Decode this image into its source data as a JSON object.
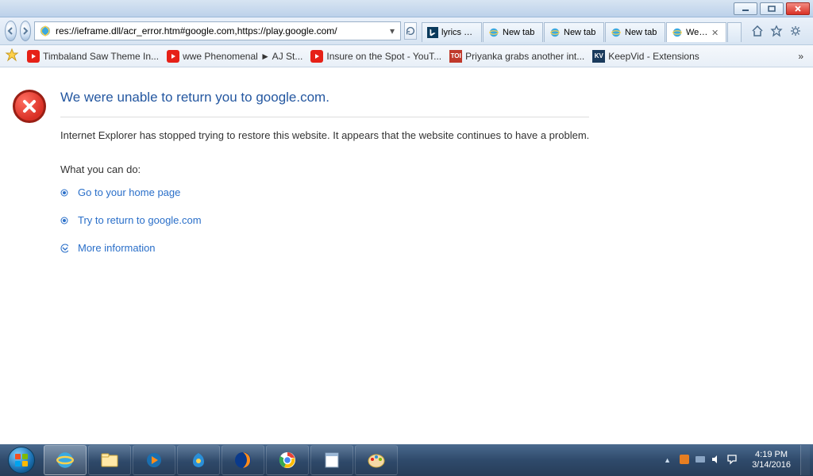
{
  "address": "res://ieframe.dll/acr_error.htm#google.com,https://play.google.com/",
  "tabs": [
    {
      "label": "lyrics + ...",
      "icon": "bing"
    },
    {
      "label": "New tab",
      "icon": "ie"
    },
    {
      "label": "New tab",
      "icon": "ie"
    },
    {
      "label": "New tab",
      "icon": "ie"
    },
    {
      "label": "Web...",
      "icon": "ie",
      "active": true
    }
  ],
  "favorites": [
    {
      "label": "Timbaland Saw Theme In...",
      "icon": "youtube"
    },
    {
      "label": "wwe Phenomenal ► AJ St...",
      "icon": "youtube"
    },
    {
      "label": "Insure on the Spot - YouT...",
      "icon": "youtube"
    },
    {
      "label": "Priyanka grabs another int...",
      "icon": "toi"
    },
    {
      "label": "KeepVid - Extensions",
      "icon": "kv"
    }
  ],
  "error": {
    "title": "We were unable to return you to google.com.",
    "message": "Internet Explorer has stopped trying to restore this website. It appears that the website continues to have a problem.",
    "subheading": "What you can do:",
    "actions": {
      "home": "Go to your home page",
      "retry": "Try to return to google.com",
      "more": "More information"
    }
  },
  "clock": {
    "time": "4:19 PM",
    "date": "3/14/2016"
  }
}
